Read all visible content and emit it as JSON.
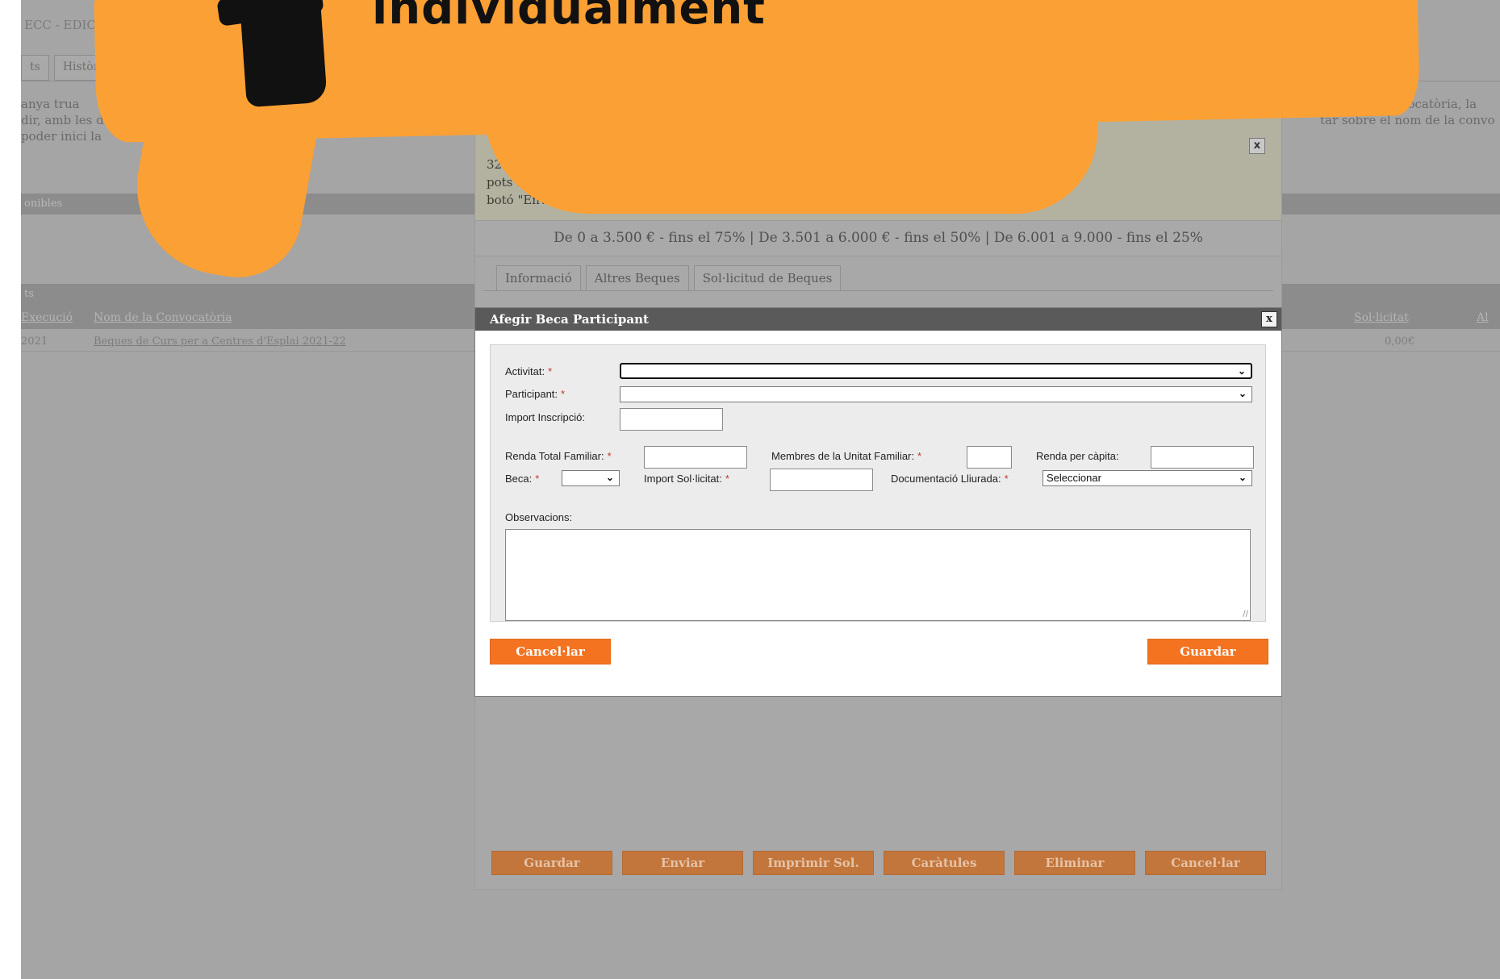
{
  "background": {
    "title": "ECC - EDICI",
    "tabs": [
      "ts",
      "Històric de"
    ],
    "text_lines": [
      "anya trua",
      "dir, amb les d",
      "poder inici  la",
      "vocatòria, la",
      "tar sobre el nom de la convo"
    ],
    "section1_label": "onibles",
    "section2_label": "ts",
    "table_headers": [
      "Execució",
      "Nom de la Convocatòria",
      "Sol·licitat",
      "Al"
    ],
    "row": {
      "year": "2021",
      "name": "Beques de Curs per a Centres d'Esplai 2021-22",
      "amount": "0,00€"
    }
  },
  "outer_dialog": {
    "info_lines": [
      "32 dies per la data límit d... t. Recorda que",
      "pots ... tramitada ... que pr... s el",
      "botó \"Enviar\". Un ... enviat ... stant pots anar prement \"Guardar\"."
    ],
    "close_label": "x",
    "range_text": "De 0 a 3.500 € - fins el 75% | De 3.501 a 6.000 € - fins el 50% | De 6.001 a 9.000 - fins el 25%",
    "tabs": [
      "Informació",
      "Altres Beques",
      "Sol·licitud de Beques"
    ],
    "buttons": [
      "Guardar",
      "Enviar",
      "Imprimir Sol.",
      "Caràtules",
      "Eliminar",
      "Cancel·lar"
    ]
  },
  "modal": {
    "title": "Afegir Beca Participant",
    "close_label": "x",
    "fields": {
      "activitat_label": "Activitat:",
      "participant_label": "Participant:",
      "import_inscripcio_label": "Import Inscripció:",
      "renda_total_label": "Renda Total Familiar:",
      "membres_label": "Membres de la Unitat Familiar:",
      "renda_capita_label": "Renda per càpita:",
      "beca_label": "Beca:",
      "import_sollicitat_label": "Import Sol·licitat:",
      "documentacio_label": "Documentació Lliurada:",
      "documentacio_value": "Seleccionar",
      "observacions_label": "Observacions:"
    },
    "required_marker": "*",
    "cancel_label": "Cancel·lar",
    "save_label": "Guardar"
  },
  "banner": {
    "text": "individualment"
  },
  "colors": {
    "accent_orange": "#f47321",
    "banner_orange": "#fba034",
    "overlay_gray": "#a5a5a5",
    "modal_header": "#5a5a5a"
  }
}
